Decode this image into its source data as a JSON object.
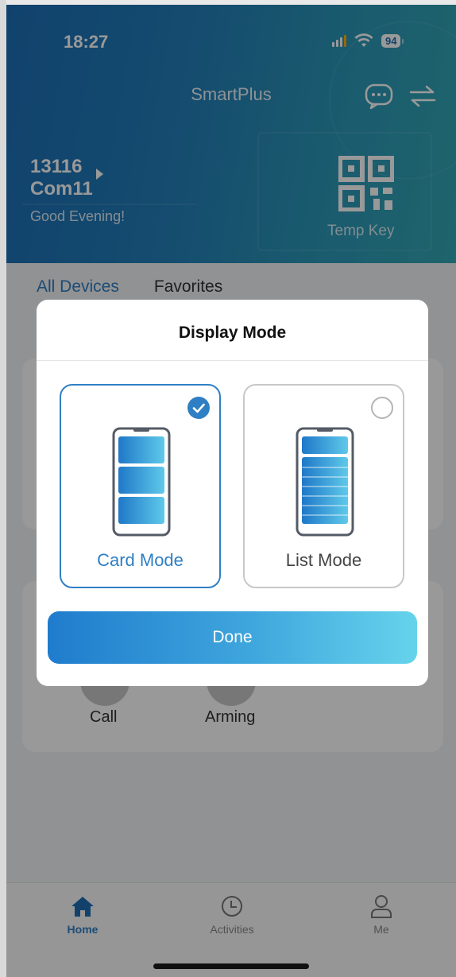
{
  "status_bar": {
    "time": "18:27",
    "battery": "94"
  },
  "header": {
    "title": "SmartPlus",
    "address_line1": "13116",
    "address_line2": "Com11",
    "greeting": "Good Evening!",
    "temp_key_label": "Temp Key"
  },
  "tabs": [
    {
      "label": "All Devices",
      "active": true
    },
    {
      "label": "Favorites",
      "active": false
    }
  ],
  "background_actions": [
    {
      "label": "Call"
    },
    {
      "label": "Arming"
    }
  ],
  "modal": {
    "title": "Display Mode",
    "options": [
      {
        "label": "Card Mode",
        "selected": true
      },
      {
        "label": "List Mode",
        "selected": false
      }
    ],
    "done_label": "Done"
  },
  "bottom_nav": [
    {
      "label": "Home",
      "icon": "home-icon",
      "active": true
    },
    {
      "label": "Activities",
      "icon": "clock-icon",
      "active": false
    },
    {
      "label": "Me",
      "icon": "person-icon",
      "active": false
    }
  ],
  "colors": {
    "accent": "#2f7fc4",
    "header_gradient_start": "#1c6fb6",
    "header_gradient_end": "#33a8b4",
    "done_gradient_end": "#66d3ec"
  }
}
